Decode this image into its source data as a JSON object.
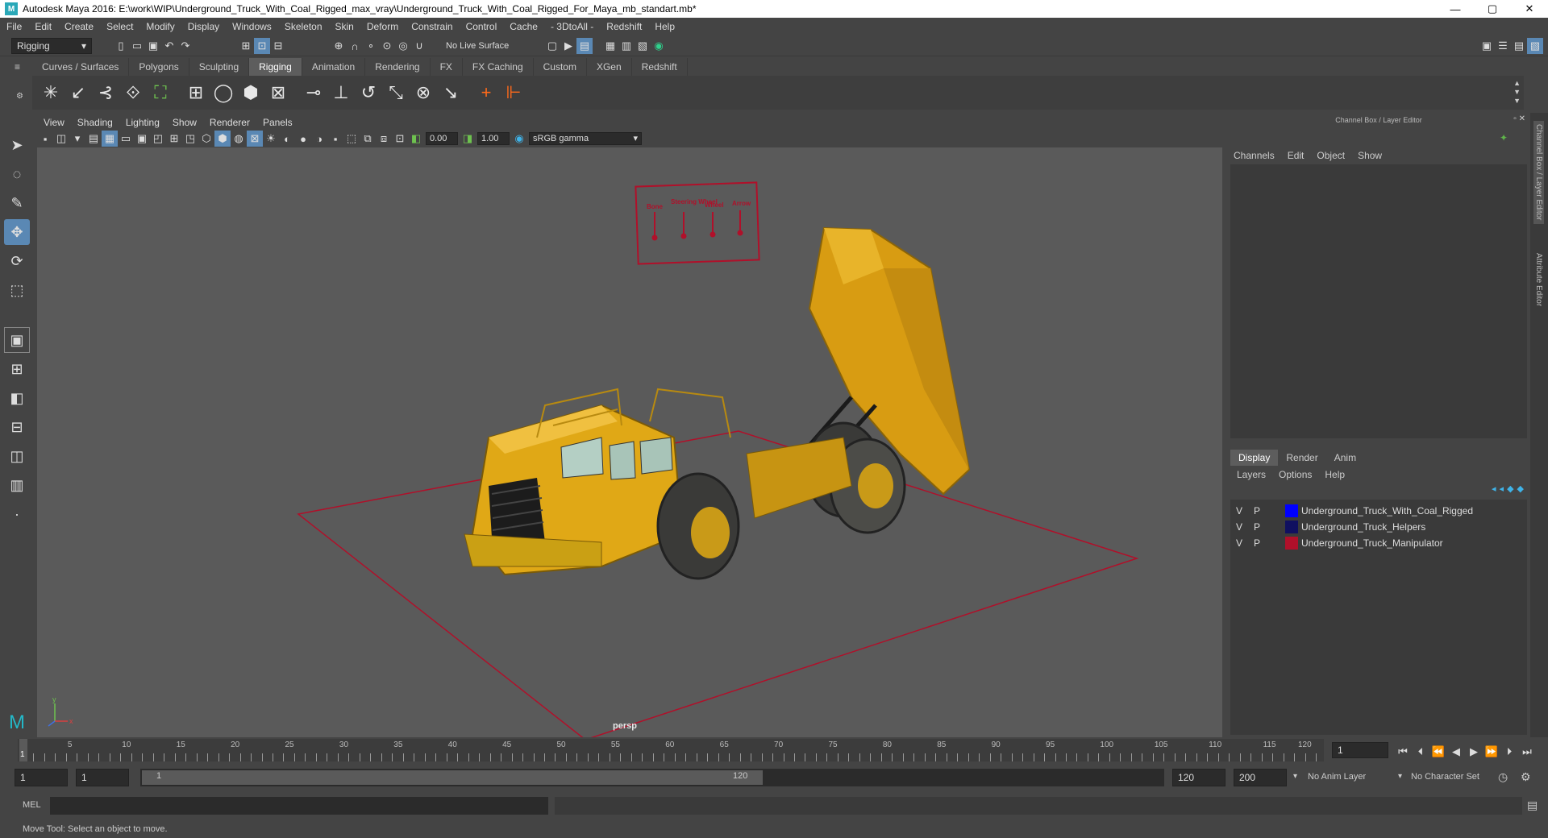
{
  "title": "Autodesk Maya 2016: E:\\work\\WIP\\Underground_Truck_With_Coal_Rigged_max_vray\\Underground_Truck_With_Coal_Rigged_For_Maya_mb_standart.mb*",
  "window_controls": {
    "minimize": "—",
    "maximize": "▢",
    "close": "✕"
  },
  "menu": [
    "File",
    "Edit",
    "Create",
    "Select",
    "Modify",
    "Display",
    "Windows",
    "Skeleton",
    "Skin",
    "Deform",
    "Constrain",
    "Control",
    "Cache",
    "- 3DtoAll -",
    "Redshift",
    "Help"
  ],
  "status": {
    "menuset": "Rigging",
    "live_surface": "No Live Surface"
  },
  "shelf_tabs": [
    "Curves / Surfaces",
    "Polygons",
    "Sculpting",
    "Rigging",
    "Animation",
    "Rendering",
    "FX",
    "FX Caching",
    "Custom",
    "XGen",
    "Redshift"
  ],
  "active_shelf_tab": "Rigging",
  "panel_menu": [
    "View",
    "Shading",
    "Lighting",
    "Show",
    "Renderer",
    "Panels"
  ],
  "panel_tools": {
    "exposure": "0.00",
    "gamma": "1.00",
    "color_space": "sRGB gamma"
  },
  "viewport": {
    "camera_label": "persp",
    "axis_y": "y",
    "axis_x": "x"
  },
  "manipulator_labels": [
    "Bone",
    "Steering Wheel",
    "Wheel",
    "Arrow"
  ],
  "right_panel": {
    "header": "Channel Box / Layer Editor",
    "channel_menu": [
      "Channels",
      "Edit",
      "Object",
      "Show"
    ],
    "layer_tabs": [
      "Display",
      "Render",
      "Anim"
    ],
    "active_layer_tab": "Display",
    "layer_menu": [
      "Layers",
      "Options",
      "Help"
    ],
    "layers": [
      {
        "v": "V",
        "p": "P",
        "color": "#0000ff",
        "name": "Underground_Truck_With_Coal_Rigged"
      },
      {
        "v": "V",
        "p": "P",
        "color": "#101060",
        "name": "Underground_Truck_Helpers"
      },
      {
        "v": "V",
        "p": "P",
        "color": "#b0102a",
        "name": "Underground_Truck_Manipulator"
      }
    ]
  },
  "side_tabs": [
    "Channel Box / Layer Editor",
    "Attribute Editor"
  ],
  "timeline": {
    "ticks": [
      "5",
      "10",
      "15",
      "20",
      "25",
      "30",
      "35",
      "40",
      "45",
      "50",
      "55",
      "60",
      "65",
      "70",
      "75",
      "80",
      "85",
      "90",
      "95",
      "100",
      "105",
      "110",
      "115",
      "120"
    ],
    "current_marker": "1",
    "current_frame": "1"
  },
  "range": {
    "start": "1",
    "playback_start": "1",
    "slider_start": "1",
    "slider_end": "120",
    "playback_end": "120",
    "end": "200",
    "anim_layer": "No Anim Layer",
    "character_set": "No Character Set"
  },
  "cmd": {
    "label": "MEL"
  },
  "help_line": "Move Tool: Select an object to move.",
  "colors": {
    "accent": "#5a88b4",
    "truck": "#e0a816",
    "manipulator": "#b0102a"
  }
}
